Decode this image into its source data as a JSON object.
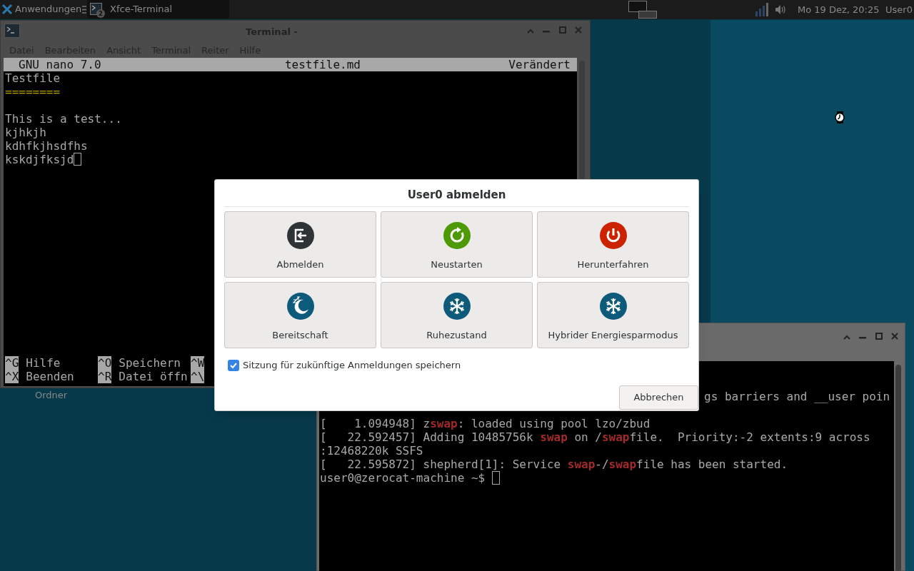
{
  "panel": {
    "app_menu": "Anwendungen",
    "task": {
      "label": "Xfce-Terminal",
      "badge": "2",
      "selected": true
    },
    "clock": "Mo 19 Dez, 20:25",
    "user": "User0"
  },
  "desktop_icons": [
    {
      "label": "Ordner"
    }
  ],
  "editor_window": {
    "title": "Terminal -",
    "menu": [
      "Datei",
      "Bearbeiten",
      "Ansicht",
      "Terminal",
      "Reiter",
      "Hilfe"
    ],
    "nano_header": {
      "version": "GNU nano 7.0",
      "file": "testfile.md",
      "state": "Verändert"
    },
    "lines": [
      {
        "kind": "text",
        "segments": [
          {
            "text": "Testfile",
            "highlight": false
          }
        ]
      },
      {
        "kind": "text",
        "segments": [
          {
            "text": "========",
            "highlight": true
          }
        ]
      },
      {
        "kind": "blank"
      },
      {
        "kind": "text",
        "segments": [
          {
            "text": "This is a test...",
            "highlight": false
          }
        ]
      },
      {
        "kind": "text",
        "segments": [
          {
            "text": "kjhkjh",
            "highlight": false
          }
        ]
      },
      {
        "kind": "text",
        "segments": [
          {
            "text": "kdhfkjhsdfhs",
            "highlight": false
          }
        ]
      },
      {
        "kind": "text",
        "segments": [
          {
            "text": "kskdjfksjd",
            "highlight": false
          }
        ]
      }
    ],
    "shortcuts": [
      [
        {
          "key": "^G",
          "label": "Hilfe"
        },
        {
          "key": "^O",
          "label": "Speichern"
        },
        {
          "key": "^W"
        }
      ],
      [
        {
          "key": "^X",
          "label": "Beenden"
        },
        {
          "key": "^R",
          "label": "Datei öffn"
        },
        {
          "key": "^\\"
        }
      ]
    ]
  },
  "terminal_window": {
    "overlapped_line": "gs barriers and __user poin",
    "lines": [
      [
        {
          "text": "[    1.094948] z",
          "highlight": false
        },
        {
          "text": "swap",
          "highlight": true
        },
        {
          "text": ": loaded using pool lzo/zbud",
          "highlight": false
        }
      ],
      [
        {
          "text": "[   22.592457] Adding 10485756k ",
          "highlight": false
        },
        {
          "text": "swap",
          "highlight": true
        },
        {
          "text": " on /",
          "highlight": false
        },
        {
          "text": "swap",
          "highlight": true
        },
        {
          "text": "file.  Priority:-2 extents:9 across",
          "highlight": false
        }
      ],
      [
        {
          "text": ":12468220k SSFS",
          "highlight": false
        }
      ],
      [
        {
          "text": "[   22.595872] shepherd[1]: Service ",
          "highlight": false
        },
        {
          "text": "swap",
          "highlight": true
        },
        {
          "text": "-/",
          "highlight": false
        },
        {
          "text": "swap",
          "highlight": true
        },
        {
          "text": "file has been started.",
          "highlight": false
        }
      ]
    ],
    "prompt": "user0@zerocat-machine ~$"
  },
  "dialog": {
    "title": "User0 abmelden",
    "actions": [
      {
        "label": "Abmelden",
        "kind": "logout"
      },
      {
        "label": "Neustarten",
        "kind": "restart"
      },
      {
        "label": "Herunterfahren",
        "kind": "shutdown"
      },
      {
        "label": "Bereitschaft",
        "kind": "suspend"
      },
      {
        "label": "Ruhezustand",
        "kind": "hibernate"
      },
      {
        "label": "Hybrider Energiesparmodus",
        "kind": "hybrid"
      }
    ],
    "remember": {
      "label": "Sitzung für zukünftige Anmeldungen speichern",
      "checked": true
    },
    "cancel": "Abbrechen"
  }
}
